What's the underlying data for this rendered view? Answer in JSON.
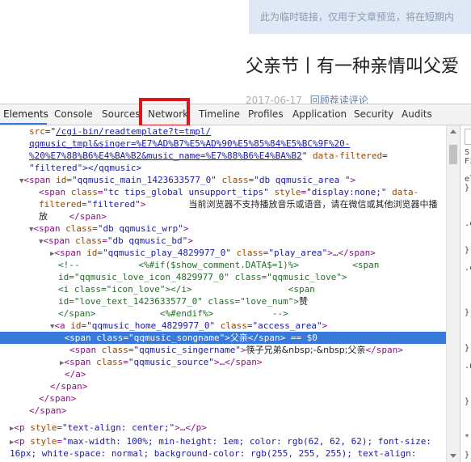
{
  "page": {
    "notice": "此为临时链接，仅用于文章预览，将在短期内",
    "title": "父亲节丨有一种亲情叫父爱",
    "meta_date": "2017-06-17",
    "meta_link": "回顾荐读评论"
  },
  "devtools": {
    "tabs": [
      "Elements",
      "Console",
      "Sources",
      "Network",
      "Timeline",
      "Profiles",
      "Application",
      "Security",
      "Audits"
    ],
    "active_tab": "Elements",
    "highlighted_tab": "Network",
    "accent": "#3879d9",
    "highlight_color": "#e0121a"
  },
  "dom": {
    "l0_src_attr": "src",
    "l0_src_val": "/cgi-bin/readtemplate?t=tmpl/",
    "l1": "qqmusic_tmpl&singer=%E7%AD%B7%E5%AD%90%E5%85%84%E5%BC%9F%20-",
    "l2a": "%20%E7%88%B6%E4%BA%B2&music_name=%E7%88%B6%E4%BA%B2",
    "l2b_attr": "data-filtered",
    "l3": "\"filtered\"></qqmusic>",
    "l4_tag": "<span",
    "l4_attr1": "id",
    "l4_val1": "\"qqmusic_main_1423633577_0\"",
    "l4_attr2": "class",
    "l4_val2": "\"db qqmusic_area \"",
    "l5_tag": "<span",
    "l5_attr1": "class",
    "l5_val1": "\"tc tips_global unsupport_tips\"",
    "l5_attr2": "style",
    "l5_val2": "\"display:none;\"",
    "l5_attr3": "data-",
    "l6_attr": "filtered",
    "l6_val": "\"filtered\"",
    "l6_text": "当前浏览器不支持播放音乐或语音，请在微信或其他浏览器中播",
    "l7_text": "放",
    "l7_tag": "</span>",
    "l8_tag": "<span",
    "l8_attr": "class",
    "l8_val": "\"db qqmusic_wrp\"",
    "l9_tag": "<span",
    "l9_attr": "class",
    "l9_val": "\"db qqmusic_bd\"",
    "l10_tag": "<span",
    "l10_attr1": "id",
    "l10_val1": "\"qqmusic_play_4829977_0\"",
    "l10_attr2": "class",
    "l10_val2": "\"play_area\"",
    "l10_end": "…</span>",
    "l11_cm1": "<!--",
    "l11_cm2": "<%#if($show_comment.DATA$=1)%>",
    "l11_cm3": "<span",
    "l12": "id=\"qqmusic_love_icon_4829977_0\" class=\"qqmusic_love\">",
    "l13a": "<i class=\"icon_love\"></i>",
    "l13b": "<span",
    "l14": "id=\"love_text_1423633577_0\" class=\"love_num\">",
    "l14_text": "赞",
    "l15a": "</span>",
    "l15b": "<%#endif%>",
    "l15c": "-->",
    "l16_tag": "<a",
    "l16_attr1": "id",
    "l16_val1": "\"qqmusic_home_4829977_0\"",
    "l16_attr2": "class",
    "l16_val2": "\"access_area\"",
    "l17_tag": "<span",
    "l17_attr": "class",
    "l17_val": "\"qqmusic_songname\"",
    "l17_text": "父亲",
    "l17_close": "</span>",
    "l17_eq": "== $0",
    "l18_tag": "<span",
    "l18_attr": "class",
    "l18_val": "\"qqmusic_singername\"",
    "l18_text": "筷子兄弟&nbsp;-&nbsp;父亲",
    "l18_close": "</span>",
    "l19_tag": "<span",
    "l19_attr": "class",
    "l19_val": "\"qqmusic_source\"",
    "l19_end": "…</span>",
    "l20": "</a>",
    "l21": "</span>",
    "l22": "</span>",
    "l23": "</span>",
    "l24_tag": "<p",
    "l24_attr": "style",
    "l24_val": "\"text-align: center;\"",
    "l24_end": "…</p>",
    "l25_tag": "<p",
    "l25_attr": "style",
    "l25_val": "\"max-width: 100%; min-height: 1em; color: rgb(62, 62, 62); font-size:",
    "l26_val": "16px; white-space: normal; background-color: rgb(255, 255, 255); text-align:"
  },
  "styles_pane": {
    "lines": [
      "S",
      "Fi",
      "",
      "el",
      "}",
      "",
      "",
      "",
      ".c",
      "",
      "",
      "}",
      "",
      ".c",
      "",
      "",
      "",
      "",
      "}",
      "",
      "",
      "",
      "}",
      "",
      ".n",
      "",
      "",
      "",
      "}",
      "",
      "",
      "",
      "*",
      "",
      "}"
    ]
  }
}
